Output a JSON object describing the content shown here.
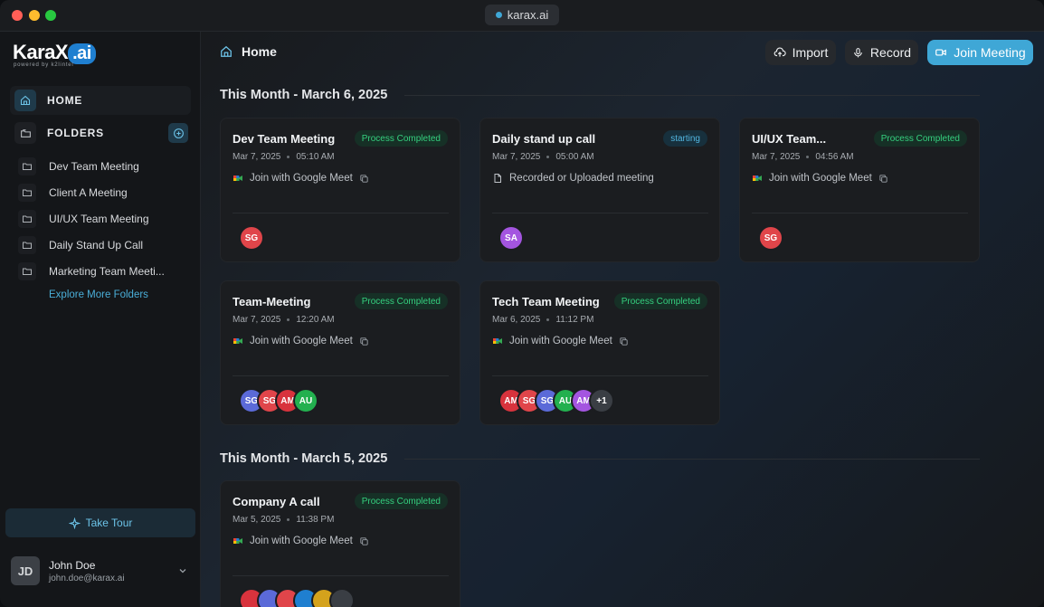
{
  "titlebar": {
    "url": "karax.ai"
  },
  "sidebar": {
    "logo_main": "KaraX",
    "logo_ai": ".ai",
    "logo_sub": "powered by k2lintel",
    "home_label": "HOME",
    "folders_label": "FOLDERS",
    "folders": [
      {
        "label": "Dev Team Meeting"
      },
      {
        "label": "Client A Meeting"
      },
      {
        "label": "UI/UX Team Meeting"
      },
      {
        "label": "Daily Stand Up Call"
      },
      {
        "label": "Marketing Team Meeti..."
      }
    ],
    "explore_label": "Explore More Folders",
    "take_tour_label": "Take Tour",
    "user": {
      "initials": "JD",
      "name": "John Doe",
      "email": "john.doe@karax.ai"
    }
  },
  "header": {
    "breadcrumb": "Home",
    "import_label": "Import",
    "record_label": "Record",
    "join_label": "Join Meeting"
  },
  "colors": {
    "accent": "#3fa7d6",
    "success": "#35d07f"
  },
  "sections": [
    {
      "title": "This Month - March 6, 2025",
      "cards": [
        {
          "title": "Dev Team Meeting",
          "status": "Process Completed",
          "status_type": "done",
          "date": "Mar 7, 2025",
          "time": "05:10 AM",
          "source": "Join with Google Meet",
          "source_type": "meet",
          "avatars": [
            {
              "initials": "SG",
              "color": "#e0454a"
            }
          ]
        },
        {
          "title": "Daily stand up call",
          "status": "starting",
          "status_type": "start",
          "date": "Mar 7, 2025",
          "time": "05:00 AM",
          "source": "Recorded or Uploaded meeting",
          "source_type": "file",
          "avatars": [
            {
              "initials": "SA",
              "color": "#a455e0"
            }
          ]
        },
        {
          "title": "UI/UX Team...",
          "status": "Process Completed",
          "status_type": "done",
          "date": "Mar 7, 2025",
          "time": "04:56 AM",
          "source": "Join with Google Meet",
          "source_type": "meet",
          "avatars": [
            {
              "initials": "SG",
              "color": "#e0454a"
            }
          ]
        },
        {
          "title": "Team-Meeting",
          "status": "Process Completed",
          "status_type": "done",
          "date": "Mar 7, 2025",
          "time": "12:20 AM",
          "source": "Join with Google Meet",
          "source_type": "meet",
          "avatars": [
            {
              "initials": "SG",
              "color": "#5b6ad8"
            },
            {
              "initials": "SG",
              "color": "#e0454a"
            },
            {
              "initials": "AM",
              "color": "#d8333d"
            },
            {
              "initials": "AU",
              "color": "#23b04f"
            }
          ]
        },
        {
          "title": "Tech Team Meeting",
          "status": "Process Completed",
          "status_type": "done",
          "date": "Mar 6, 2025",
          "time": "11:12 PM",
          "source": "Join with Google Meet",
          "source_type": "meet",
          "avatars": [
            {
              "initials": "AM",
              "color": "#d8333d"
            },
            {
              "initials": "SG",
              "color": "#e0454a"
            },
            {
              "initials": "SG",
              "color": "#5b6ad8"
            },
            {
              "initials": "AU",
              "color": "#23b04f"
            },
            {
              "initials": "AM",
              "color": "#a455e0"
            },
            {
              "initials": "+1",
              "color": "#3a3e44"
            }
          ]
        }
      ]
    },
    {
      "title": "This Month - March 5, 2025",
      "cards": [
        {
          "title": "Company A call",
          "status": "Process Completed",
          "status_type": "done",
          "date": "Mar 5, 2025",
          "time": "11:38 PM",
          "source": "Join with Google Meet",
          "source_type": "meet",
          "avatars": [
            {
              "initials": "",
              "color": "#d8333d"
            },
            {
              "initials": "",
              "color": "#5b6ad8"
            },
            {
              "initials": "",
              "color": "#e0454a"
            },
            {
              "initials": "",
              "color": "#1f7fd0"
            },
            {
              "initials": "",
              "color": "#d4a21c"
            },
            {
              "initials": "",
              "color": "#3a3e44"
            }
          ]
        }
      ]
    }
  ]
}
